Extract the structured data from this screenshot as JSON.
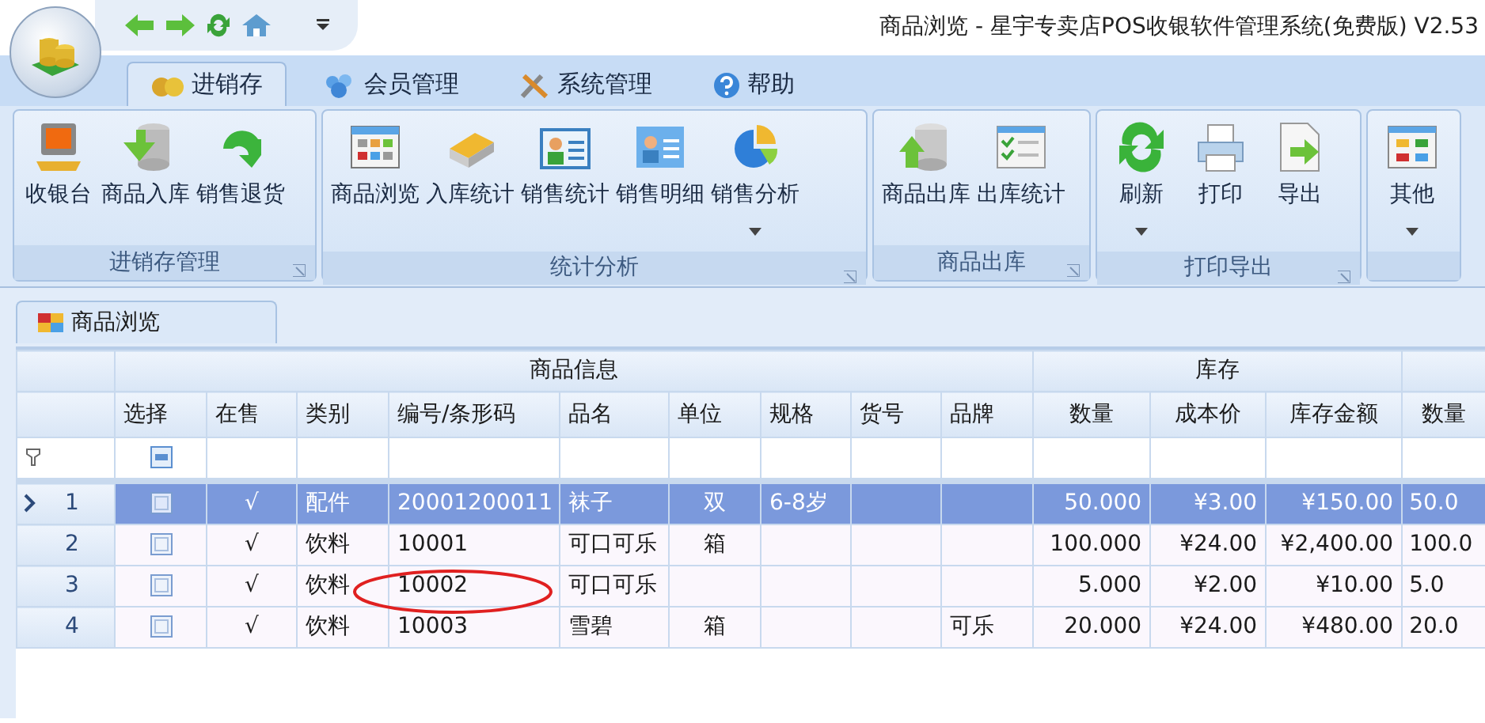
{
  "window": {
    "title": "商品浏览 - 星宇专卖店POS收银软件管理系统(免费版) V2.53"
  },
  "ribbon_tabs": [
    {
      "label": "进销存",
      "selected": true
    },
    {
      "label": "会员管理",
      "selected": false
    },
    {
      "label": "系统管理",
      "selected": false
    },
    {
      "label": "帮助",
      "selected": false
    }
  ],
  "ribbon_groups": [
    {
      "label": "进销存管理",
      "buttons": [
        {
          "label": "收银台",
          "dropdown": false
        },
        {
          "label": "商品入库",
          "dropdown": false
        },
        {
          "label": "销售退货",
          "dropdown": false
        }
      ]
    },
    {
      "label": "统计分析",
      "buttons": [
        {
          "label": "商品浏览",
          "dropdown": false
        },
        {
          "label": "入库统计",
          "dropdown": false
        },
        {
          "label": "销售统计",
          "dropdown": false
        },
        {
          "label": "销售明细",
          "dropdown": false
        },
        {
          "label": "销售分析",
          "dropdown": true
        }
      ]
    },
    {
      "label": "商品出库",
      "buttons": [
        {
          "label": "商品出库",
          "dropdown": false
        },
        {
          "label": "出库统计",
          "dropdown": false
        }
      ]
    },
    {
      "label": "打印导出",
      "buttons": [
        {
          "label": "刷新",
          "dropdown": true
        },
        {
          "label": "打印",
          "dropdown": false
        },
        {
          "label": "导出",
          "dropdown": false
        }
      ]
    },
    {
      "buttons": [
        {
          "label": "其他",
          "dropdown": true
        }
      ]
    }
  ],
  "document_tab": {
    "label": "商品浏览"
  },
  "table": {
    "column_groups": [
      {
        "label": "商品信息",
        "columns": [
          "选择",
          "在售",
          "类别",
          "编号/条形码",
          "品名",
          "单位",
          "规格",
          "货号",
          "品牌"
        ]
      },
      {
        "label": "库存",
        "columns": [
          "数量",
          "成本价",
          "库存金额"
        ]
      },
      {
        "columns": [
          "数量"
        ]
      }
    ],
    "rows": [
      {
        "number": "1",
        "selected": true,
        "checked": false,
        "cells": [
          "",
          "√",
          "配件",
          "20001200011",
          "袜子",
          "双",
          "6-8岁",
          "",
          "",
          "50.000",
          "¥3.00",
          "¥150.00",
          "50.0"
        ]
      },
      {
        "number": "2",
        "selected": false,
        "checked": false,
        "cells": [
          "",
          "√",
          "饮料",
          "10001",
          "可口可乐",
          "箱",
          "",
          "",
          "",
          "100.000",
          "¥24.00",
          "¥2,400.00",
          "100.0"
        ]
      },
      {
        "number": "3",
        "selected": false,
        "checked": false,
        "cells": [
          "",
          "√",
          "饮料",
          "10002",
          "可口可乐",
          "",
          "",
          "",
          "",
          "5.000",
          "¥2.00",
          "¥10.00",
          "5.0"
        ]
      },
      {
        "number": "4",
        "selected": false,
        "checked": false,
        "cells": [
          "",
          "√",
          "饮料",
          "10003",
          "雪碧",
          "箱",
          "",
          "",
          "可乐",
          "20.000",
          "¥24.00",
          "¥480.00",
          "20.0"
        ]
      }
    ]
  },
  "annotations": [
    {
      "kind": "ellipse"
    }
  ]
}
